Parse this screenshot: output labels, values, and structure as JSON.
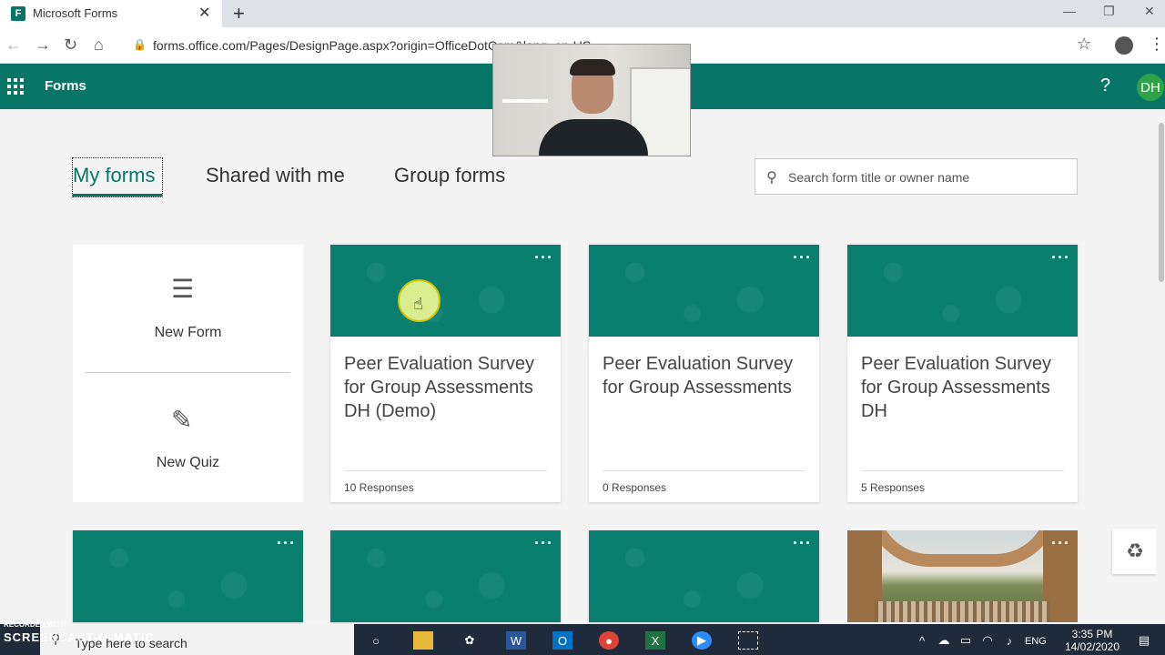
{
  "browser": {
    "tab_title": "Microsoft Forms",
    "tab_favicon_letter": "F",
    "url": "forms.office.com/Pages/DesignPage.aspx?origin=OfficeDotCom&lang=en-US"
  },
  "app": {
    "title": "Forms",
    "help_label": "?",
    "avatar_initials": "DH",
    "brand_color": "#077568"
  },
  "pivots": [
    {
      "label": "My forms",
      "active": true
    },
    {
      "label": "Shared with me",
      "active": false
    },
    {
      "label": "Group forms",
      "active": false
    }
  ],
  "search": {
    "placeholder": "Search form title or owner name"
  },
  "new_panel": {
    "new_form_label": "New Form",
    "new_quiz_label": "New Quiz"
  },
  "cards": [
    {
      "title": "Peer Evaluation Survey for Group Assessments DH (Demo)",
      "responses": "10 Responses"
    },
    {
      "title": "Peer Evaluation Survey for Group Assessments",
      "responses": "0 Responses"
    },
    {
      "title": "Peer Evaluation Survey for Group Assessments DH",
      "responses": "5 Responses"
    }
  ],
  "card_more_label": "···",
  "taskbar": {
    "search_text": "Type here to search",
    "language": "ENG",
    "time": "3:35 PM",
    "date": "14/02/2020"
  },
  "watermark": {
    "line1": "RECORDED WITH",
    "line2": "SCREENCAST-O-MATIC"
  }
}
